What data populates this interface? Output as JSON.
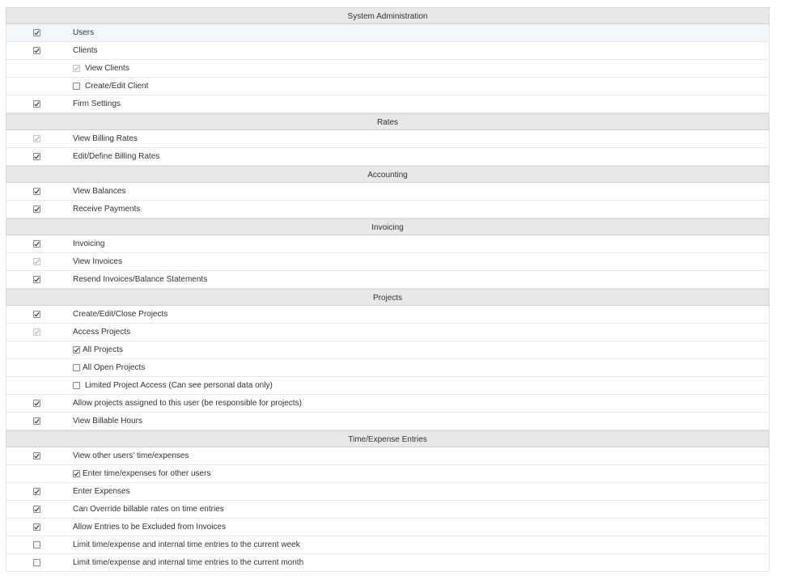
{
  "sections": [
    {
      "title": "System Administration",
      "rows": [
        {
          "label": "Users",
          "state": "checked",
          "nested": false,
          "highlight": true
        },
        {
          "label": "Clients",
          "state": "checked",
          "nested": false
        },
        {
          "label": "View Clients",
          "state": "checked-disabled",
          "nested": true
        },
        {
          "label": "Create/Edit Client",
          "state": "unchecked",
          "nested": true
        },
        {
          "label": "Firm Settings",
          "state": "checked",
          "nested": false
        }
      ]
    },
    {
      "title": "Rates",
      "rows": [
        {
          "label": "View Billing Rates",
          "state": "checked-disabled",
          "nested": false
        },
        {
          "label": "Edit/Define Billing Rates",
          "state": "checked",
          "nested": false
        }
      ]
    },
    {
      "title": "Accounting",
      "rows": [
        {
          "label": "View Balances",
          "state": "checked",
          "nested": false
        },
        {
          "label": "Receive Payments",
          "state": "checked",
          "nested": false
        }
      ]
    },
    {
      "title": "Invoicing",
      "rows": [
        {
          "label": "Invoicing",
          "state": "checked",
          "nested": false
        },
        {
          "label": "View Invoices",
          "state": "checked-disabled",
          "nested": false
        },
        {
          "label": "Resend Invoices/Balance Statements",
          "state": "checked",
          "nested": false
        }
      ]
    },
    {
      "title": "Projects",
      "rows": [
        {
          "label": "Create/Edit/Close Projects",
          "state": "checked",
          "nested": false
        },
        {
          "label": "Access Projects",
          "state": "checked-disabled",
          "nested": false
        },
        {
          "label": "All Projects",
          "state": "checked",
          "nested": true,
          "tight": true
        },
        {
          "label": "All Open Projects",
          "state": "unchecked",
          "nested": true,
          "tight": true
        },
        {
          "label": "Limited Project Access (Can see personal data only)",
          "state": "unchecked",
          "nested": true
        },
        {
          "label": "Allow projects assigned to this user (be responsible for projects)",
          "state": "checked",
          "nested": false
        },
        {
          "label": "View Billable Hours",
          "state": "checked",
          "nested": false
        }
      ]
    },
    {
      "title": "Time/Expense Entries",
      "rows": [
        {
          "label": "View other users' time/expenses",
          "state": "checked",
          "nested": false
        },
        {
          "label": "Enter time/expenses for other users",
          "state": "checked",
          "nested": true,
          "tight": true
        },
        {
          "label": "Enter Expenses",
          "state": "checked",
          "nested": false
        },
        {
          "label": "Can Override billable rates on time entries",
          "state": "checked",
          "nested": false
        },
        {
          "label": "Allow Entries to be Excluded from Invoices",
          "state": "checked",
          "nested": false
        },
        {
          "label": "Limit time/expense and internal time entries to the current week",
          "state": "unchecked",
          "nested": false
        },
        {
          "label": "Limit time/expense and internal time entries to the current month",
          "state": "unchecked",
          "nested": false
        }
      ]
    }
  ]
}
